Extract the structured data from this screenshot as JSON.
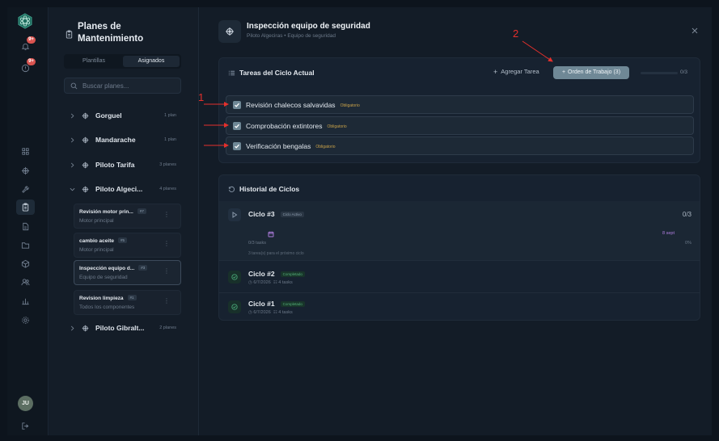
{
  "rail": {
    "logo_icon": "hex-flower-logo",
    "items": [
      {
        "icon": "bell-icon",
        "badge": "9+"
      },
      {
        "icon": "alert-circle-icon",
        "badge": "9+"
      },
      {
        "icon": "grid-icon"
      },
      {
        "icon": "ship-wheel-icon"
      },
      {
        "icon": "wrench-icon"
      },
      {
        "icon": "clipboard-icon",
        "active": true
      },
      {
        "icon": "file-icon"
      },
      {
        "icon": "folder-icon"
      },
      {
        "icon": "package-icon"
      },
      {
        "icon": "users-icon"
      },
      {
        "icon": "bar-chart-icon"
      },
      {
        "icon": "settings-icon"
      }
    ],
    "avatar": "JU",
    "logout_icon": "logout-icon"
  },
  "plans_panel": {
    "title": "Planes de Mantenimiento",
    "tabs": [
      "Plantillas",
      "Asignados"
    ],
    "active_tab": "Asignados",
    "search_placeholder": "Buscar planes...",
    "groups": [
      {
        "name": "Gorguel",
        "count": "1 plan",
        "expanded": false
      },
      {
        "name": "Mandarache",
        "count": "1 plan",
        "expanded": false
      },
      {
        "name": "Piloto Tarifa",
        "count": "3 planes",
        "expanded": false
      },
      {
        "name": "Piloto Algeci...",
        "count": "4 planes",
        "expanded": true
      },
      {
        "name": "Piloto Gibralt...",
        "count": "2 planes",
        "expanded": false
      }
    ],
    "plans": [
      {
        "name": "Revisión motor prin...",
        "id": "#7",
        "component": "Motor principal"
      },
      {
        "name": "cambio aceite",
        "id": "#5",
        "component": "Motor principal"
      },
      {
        "name": "Inspección equipo d...",
        "id": "#3",
        "component": "Equipo de seguridad",
        "selected": true
      },
      {
        "name": "Revision limpieza",
        "id": "#1",
        "component": "Todos los componentes"
      }
    ]
  },
  "detail": {
    "title": "Inspección equipo de seguridad",
    "subtitle": "Piloto Algeciras • Equipo de seguridad",
    "tasks_card": {
      "title": "Tareas del Ciclo Actual",
      "add_task_label": "Agregar Tarea",
      "work_order_label": "Orden de Trabajo (3)",
      "progress_text": "0/3",
      "progress_fraction": 0.0,
      "required_label": "Obligatorio",
      "tasks": [
        {
          "name": "Revisión chalecos salvavidas",
          "checked": true
        },
        {
          "name": "Comprobación extintores",
          "checked": true
        },
        {
          "name": "Verificación bengalas",
          "checked": true
        }
      ]
    },
    "history_card": {
      "title": "Historial de Ciclos",
      "active_cycle": {
        "name": "Ciclo #3",
        "badge": "Ciclo Activo",
        "progress": "0/3",
        "date": "8 sept",
        "tasks_text": "0/3 tasks",
        "percent": "0%",
        "next_note": "3 tarea(s) para el próximo ciclo"
      },
      "past_cycles": [
        {
          "name": "Ciclo #2",
          "badge": "Completado",
          "date": "6/7/2026",
          "tasks": "4 tasks"
        },
        {
          "name": "Ciclo #1",
          "badge": "Completado",
          "date": "6/7/2026",
          "tasks": "4 tasks"
        }
      ]
    }
  },
  "annotations": {
    "one": "1",
    "two": "2"
  },
  "colors": {
    "accent": "#6f8896",
    "required": "#c9a24a",
    "completed": "#56b07c",
    "date": "#b07ee0",
    "annotation": "#e5302c"
  }
}
